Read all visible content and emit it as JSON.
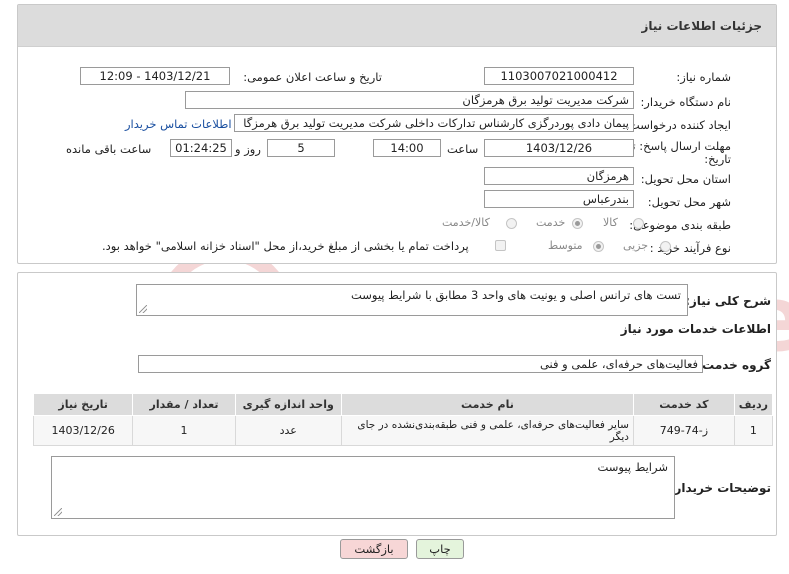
{
  "header": {
    "title": "جزئیات اطلاعات نیاز"
  },
  "form": {
    "need_number_label": "شماره نیاز:",
    "need_number": "1103007021000412",
    "announce_label": "تاریخ و ساعت اعلان عمومی:",
    "announce_value": "1403/12/21 - 12:09",
    "buyer_org_label": "نام دستگاه خریدار:",
    "buyer_org": "شرکت مدیریت تولید برق هرمزگان",
    "creator_label": "ایجاد کننده درخواست:",
    "creator": "پیمان دادی پوردرگزی کارشناس تدارکات داخلی شرکت مدیریت تولید برق هرمزگا",
    "contact_link": "اطلاعات تماس خریدار",
    "deadline_label_1": "مهلت ارسال پاسخ: تا",
    "deadline_label_2": "تاریخ:",
    "deadline_date": "1403/12/26",
    "time_label": "ساعت",
    "deadline_time": "14:00",
    "days_value": "5",
    "days_label": "روز و",
    "remaining_time": "01:24:25",
    "remaining_label": "ساعت باقی مانده",
    "province_label": "استان محل تحویل:",
    "province": "هرمزگان",
    "city_label": "شهر محل تحویل:",
    "city": "بندرعباس",
    "category_label": "طبقه بندی موضوعی:",
    "category_options": [
      "کالا",
      "خدمت",
      "کالا/خدمت"
    ],
    "category_selected": "خدمت",
    "process_label": "نوع فرآیند خرید :",
    "process_options": [
      "جزیی",
      "متوسط"
    ],
    "process_selected": "متوسط",
    "payment_note": "پرداخت تمام یا بخشی از مبلغ خرید،از محل \"اسناد خزانه اسلامی\" خواهد بود."
  },
  "summary": {
    "label": "شرح کلی نیاز:",
    "text": "تست های ترانس اصلی و یونیت های واحد 3 مطابق با شرایط پیوست"
  },
  "services": {
    "section_title": "اطلاعات خدمات مورد نیاز",
    "group_label": "گروه خدمت:",
    "group_value": "فعالیت‌های حرفه‌ای، علمی و فنی",
    "columns": [
      "ردیف",
      "کد خدمت",
      "نام خدمت",
      "واحد اندازه گیری",
      "تعداد / مقدار",
      "تاریخ نیاز"
    ],
    "rows": [
      {
        "index": "1",
        "code": "ز-74-749",
        "name": "سایر فعالیت‌های حرفه‌ای، علمی و فنی طبقه‌بندی‌نشده در جای دیگر",
        "unit": "عدد",
        "qty": "1",
        "date": "1403/12/26"
      }
    ]
  },
  "buyer_notes": {
    "label": "توضیحات خریدار:",
    "text": "شرایط پیوست"
  },
  "actions": {
    "print_label": "چاپ",
    "back_label": "بازگشت"
  },
  "colors": {
    "header_bg": "#dcdcdc",
    "link": "#1a4fa0",
    "back_button_bg": "#f7d6d6",
    "print_button_bg": "#e4f4dc",
    "watermark": "#f1c9c9"
  }
}
